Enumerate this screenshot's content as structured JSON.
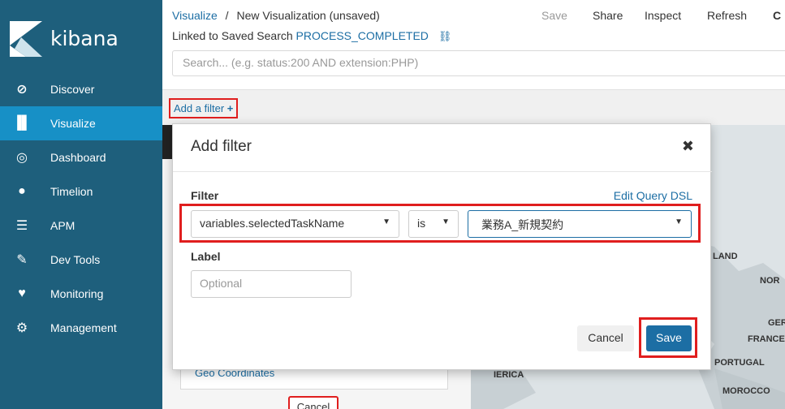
{
  "brand": {
    "name": "kibana"
  },
  "sidebar": {
    "items": [
      {
        "label": "Discover",
        "icon": "compass-icon"
      },
      {
        "label": "Visualize",
        "icon": "bar-chart-icon"
      },
      {
        "label": "Dashboard",
        "icon": "dashboard-icon"
      },
      {
        "label": "Timelion",
        "icon": "timelion-icon"
      },
      {
        "label": "APM",
        "icon": "apm-icon"
      },
      {
        "label": "Dev Tools",
        "icon": "wrench-icon"
      },
      {
        "label": "Monitoring",
        "icon": "heartbeat-icon"
      },
      {
        "label": "Management",
        "icon": "gear-icon"
      }
    ]
  },
  "breadcrumb": {
    "root": "Visualize",
    "separator": "/",
    "current": "New Visualization (unsaved)"
  },
  "linked": {
    "prefix": "Linked to Saved Search",
    "search_name": "PROCESS_COMPLETED"
  },
  "topmenu": {
    "save": "Save",
    "share": "Share",
    "inspect": "Inspect",
    "refresh": "Refresh"
  },
  "search": {
    "placeholder": "Search... (e.g. status:200 AND extension:PHP)"
  },
  "filterbar": {
    "add_filter": "Add a filter"
  },
  "modal": {
    "title": "Add filter",
    "filter_label": "Filter",
    "edit_dsl": "Edit Query DSL",
    "field_value": "variables.selectedTaskName",
    "operator_value": "is",
    "value_value": "業務A_新規契約",
    "label_label": "Label",
    "label_placeholder": "Optional",
    "cancel": "Cancel",
    "save": "Save"
  },
  "background": {
    "geo": "Geo Coordinates",
    "cancel": "Cancel"
  },
  "map": {
    "labels": [
      "LAND",
      "NOR",
      "GER",
      "FRANCE",
      "PORTUGAL",
      "MOROCCO",
      "IERICA"
    ]
  },
  "colors": {
    "sidebar": "#1e5f7c",
    "active": "#1790c6",
    "link": "#1c6ea4",
    "highlight": "#e01e1e"
  }
}
